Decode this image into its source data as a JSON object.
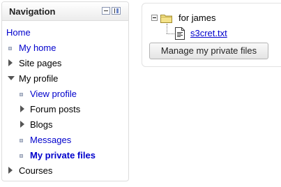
{
  "navigation": {
    "title": "Navigation",
    "items": [
      {
        "label": "Home"
      },
      {
        "label": "My home"
      },
      {
        "label": "Site pages"
      },
      {
        "label": "My profile"
      },
      {
        "label": "View profile"
      },
      {
        "label": "Forum posts"
      },
      {
        "label": "Blogs"
      },
      {
        "label": "Messages"
      },
      {
        "label": "My private files"
      },
      {
        "label": "Courses"
      }
    ]
  },
  "private_files": {
    "folder": {
      "label": "for james"
    },
    "file": {
      "label": "s3cret.txt"
    },
    "manage_button": {
      "label": "Manage my private files"
    }
  },
  "colors": {
    "link": "#0000cc",
    "border": "#dddddd"
  }
}
